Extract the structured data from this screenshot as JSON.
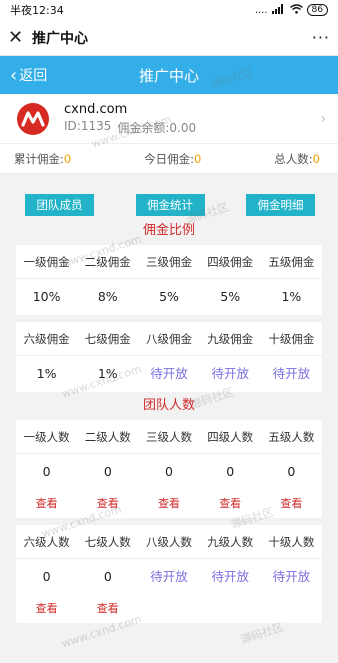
{
  "status_bar": {
    "time": "半夜12:34",
    "signal": "....",
    "wifi": "wifi-icon",
    "battery": "86"
  },
  "app_bar": {
    "title": "推广中心",
    "close_icon": "close-icon",
    "more": "···"
  },
  "nav": {
    "back_label": "返回",
    "title": "推广中心"
  },
  "profile": {
    "name": "cxnd.com",
    "id_text": "ID:1135",
    "balance_text": "佣金余额:0.00"
  },
  "summary": {
    "total_label": "累计佣金:",
    "total_value": "0",
    "today_label": "今日佣金:",
    "today_value": "0",
    "people_label": "总人数:",
    "people_value": "0"
  },
  "buttons": {
    "team": "团队成员",
    "stats": "佣金统计",
    "detail": "佣金明细"
  },
  "commission": {
    "title": "佣金比例",
    "row1_headers": [
      "一级佣金",
      "二级佣金",
      "三级佣金",
      "四级佣金",
      "五级佣金"
    ],
    "row1_values": [
      "10%",
      "8%",
      "5%",
      "5%",
      "1%"
    ],
    "row2_headers": [
      "六级佣金",
      "七级佣金",
      "八级佣金",
      "九级佣金",
      "十级佣金"
    ],
    "row2_values": [
      "1%",
      "1%",
      "待开放",
      "待开放",
      "待开放"
    ]
  },
  "team": {
    "title": "团队人数",
    "row1_headers": [
      "一级人数",
      "二级人数",
      "三级人数",
      "四级人数",
      "五级人数"
    ],
    "row1_values": [
      "0",
      "0",
      "0",
      "0",
      "0"
    ],
    "row1_links": [
      "查看",
      "查看",
      "查看",
      "查看",
      "查看"
    ],
    "row2_headers": [
      "六级人数",
      "七级人数",
      "八级人数",
      "九级人数",
      "十级人数"
    ],
    "row2_values": [
      "0",
      "0",
      "待开放",
      "待开放",
      "待开放"
    ],
    "row2_links": [
      "查看",
      "查看"
    ]
  },
  "watermarks": [
    "www.cxnd.com",
    "源码社区"
  ],
  "colors": {
    "primary": "#33aee8",
    "button": "#22b3c9",
    "accent_red": "#d02b2b",
    "value_orange": "#f2a200",
    "pending": "#7a6fe0"
  }
}
